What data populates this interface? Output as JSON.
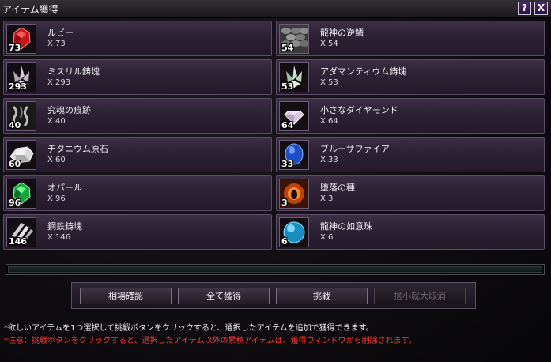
{
  "window": {
    "title": "アイテム獲得",
    "help_label": "?",
    "close_label": "X"
  },
  "items": [
    {
      "name": "ルビー",
      "qty": "X 73",
      "count": "73",
      "icon": "ruby-icon"
    },
    {
      "name": "龍神の逆鱗",
      "qty": "X 54",
      "count": "54",
      "icon": "dragon-scale-icon"
    },
    {
      "name": "ミスリル鋳塊",
      "qty": "X 293",
      "count": "293",
      "icon": "mithril-ingot-icon"
    },
    {
      "name": "アダマンティウム鋳塊",
      "qty": "X 53",
      "count": "53",
      "icon": "adamantium-ingot-icon"
    },
    {
      "name": "究魂の痕跡",
      "qty": "X 40",
      "count": "40",
      "icon": "soul-trace-icon"
    },
    {
      "name": "小さなダイヤモンド",
      "qty": "X 64",
      "count": "64",
      "icon": "diamond-icon"
    },
    {
      "name": "チタニウム原石",
      "qty": "X 60",
      "count": "60",
      "icon": "titanium-ore-icon"
    },
    {
      "name": "ブルーサファイア",
      "qty": "X 33",
      "count": "33",
      "icon": "sapphire-icon"
    },
    {
      "name": "オパール",
      "qty": "X 96",
      "count": "96",
      "icon": "opal-icon"
    },
    {
      "name": "堕落の種",
      "qty": "X 3",
      "count": "3",
      "icon": "corruption-seed-icon"
    },
    {
      "name": "鋼鉄鋳塊",
      "qty": "X 146",
      "count": "146",
      "icon": "steel-ingot-icon"
    },
    {
      "name": "龍神の如意珠",
      "qty": "X 6",
      "count": "6",
      "icon": "dragon-orb-icon"
    }
  ],
  "buttons": {
    "market": "相場確認",
    "acquire_all": "全て獲得",
    "challenge": "挑戦",
    "cancel": "捨小就大取消"
  },
  "notes": {
    "info": "*欲しいアイテムを1つ選択して挑戦ボタンをクリックすると、選択したアイテムを追加で獲得できます。",
    "warning": "*注意：挑戦ボタンをクリックすると、選択したアイテム以外の累積アイテムは、獲得ウィンドウから削除されます。"
  },
  "colors": {
    "warning_text": "#ff3b33",
    "panel": "#2e2235"
  }
}
